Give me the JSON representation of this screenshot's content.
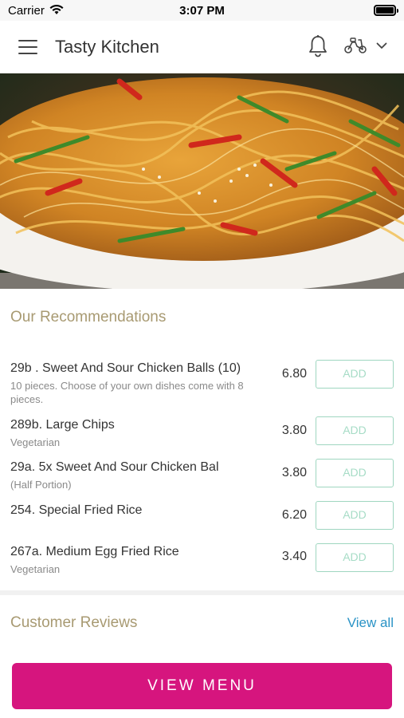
{
  "status_bar": {
    "carrier": "Carrier",
    "time": "3:07 PM"
  },
  "header": {
    "title": "Tasty Kitchen"
  },
  "recommendations": {
    "title": "Our Recommendations",
    "items": [
      {
        "name": "29b . Sweet And Sour Chicken Balls (10)",
        "description": "10 pieces. Choose of your own dishes come with 8 pieces.",
        "price": "6.80",
        "add_label": "ADD"
      },
      {
        "name": "289b. Large Chips",
        "description": "Vegetarian",
        "price": "3.80",
        "add_label": "ADD"
      },
      {
        "name": "29a. 5x Sweet And Sour Chicken Bal",
        "description": "(Half Portion)",
        "price": "3.80",
        "add_label": "ADD"
      },
      {
        "name": "254. Special Fried Rice",
        "description": "",
        "price": "6.20",
        "add_label": "ADD"
      },
      {
        "name": "267a. Medium Egg Fried Rice",
        "description": "Vegetarian",
        "price": "3.40",
        "add_label": "ADD"
      }
    ]
  },
  "reviews": {
    "title": "Customer Reviews",
    "view_all": "View all"
  },
  "footer": {
    "view_menu": "VIEW MENU"
  },
  "colors": {
    "brand": "#d6157e",
    "add_border": "#9fd6c0",
    "link": "#2a93c6",
    "section_title": "#a89a72"
  },
  "icons": [
    "menu-icon",
    "bell-icon",
    "scooter-icon",
    "chevron-down-icon",
    "wifi-icon",
    "battery-icon"
  ]
}
